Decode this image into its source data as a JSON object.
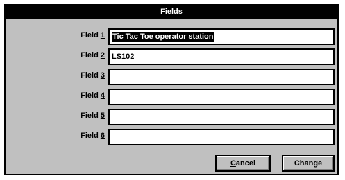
{
  "dialog": {
    "title": "Fields",
    "fields": [
      {
        "label_pre": "Field ",
        "label_key": "1",
        "value": "Tic Tac Toe operator station",
        "selected": true
      },
      {
        "label_pre": "Field ",
        "label_key": "2",
        "value": "LS102",
        "selected": false
      },
      {
        "label_pre": "Field ",
        "label_key": "3",
        "value": "",
        "selected": false
      },
      {
        "label_pre": "Field ",
        "label_key": "4",
        "value": "",
        "selected": false
      },
      {
        "label_pre": "Field ",
        "label_key": "5",
        "value": "",
        "selected": false
      },
      {
        "label_pre": "Field ",
        "label_key": "6",
        "value": "",
        "selected": false
      }
    ],
    "cancel_key": "C",
    "cancel_rest": "ancel",
    "change_label": "Change"
  }
}
